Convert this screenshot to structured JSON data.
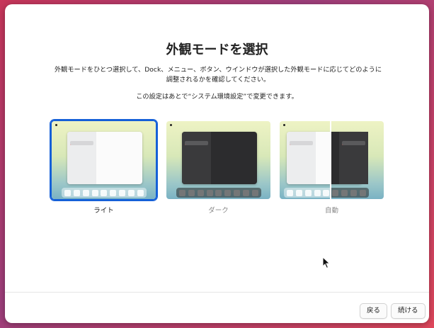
{
  "setup": {
    "title": "外観モードを選択",
    "description": "外観モードをひとつ選択して、Dock、メニュー、ボタン、ウインドウが選択した外観モードに応じてどのように調整されるかを確認してください。",
    "note": "この設定はあとで“システム環境設定”で変更できます。",
    "options": [
      {
        "label": "ライト",
        "selected": true
      },
      {
        "label": "ダーク",
        "selected": false
      },
      {
        "label": "自動",
        "selected": false
      }
    ]
  },
  "footer": {
    "back_label": "戻る",
    "continue_label": "続ける"
  },
  "colors": {
    "accent": "#1560d8",
    "wallpaper": "#c8365a"
  }
}
